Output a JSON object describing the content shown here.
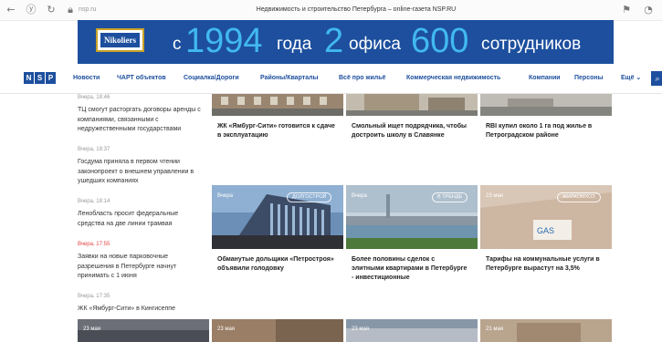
{
  "browser": {
    "url": "nsp.ru",
    "title": "Недвижимость и строительство Петербурга – online-газета NSP.RU"
  },
  "banner": {
    "logo": "Nikoliers",
    "text_prefix": "с",
    "num1": "1994",
    "word1": "года",
    "num2": "2",
    "word2": "офиса",
    "num3": "600",
    "word3": "сотрудников"
  },
  "nav": {
    "logo_letters": [
      "N",
      "S",
      "P"
    ],
    "items": [
      "Новости",
      "ЧАРТ объектов",
      "Социалка/Дороги",
      "Районы/Кварталы",
      "Всё про жильё",
      "Коммерческая недвижимость",
      "Компании",
      "Персоны",
      "Ещё"
    ]
  },
  "feed": [
    {
      "time": "Вчера, 18:46",
      "text": "ТЦ смогут расторгать договоры аренды с компаниями, связанными с недружественными государствами"
    },
    {
      "time": "Вчера, 18:37",
      "text": "Госдума приняла в первом чтении законопроект о внешнем управлении в ушедших компаниях"
    },
    {
      "time": "Вчера, 18:14",
      "text": "Ленобласть просит федеральные средства на две линии трамвая"
    },
    {
      "time": "Вчера, 17:55",
      "text": "Заявки на новые парковочные разрешения в Петербурге начнут принимать с 1 июня"
    },
    {
      "time": "Вчера, 17:35",
      "text": "ЖК «Ямбург-Сити» в Кингисеппе"
    }
  ],
  "cards_top": [
    {
      "title": "ЖК «Ямбург-Сити» готовится к сдаче в эксплуатацию"
    },
    {
      "title": "Смольный ищет подрядчика, чтобы достроить школу в Славянке"
    },
    {
      "title": "RBI купил около 1 га под жилье в Петроградском районе"
    }
  ],
  "cards_mid": [
    {
      "date": "Вчера",
      "tag": "ДОЛГОСТРОЙ",
      "title": "Обманутые дольщики «Петростроя» объявили голодовку"
    },
    {
      "date": "Вчера",
      "tag": "В ТРЕНДЕ",
      "title": "Более половины сделок с элитными квартирами в Петербурге - инвестиционные"
    },
    {
      "date": "23 мая",
      "tag": "ЖИЛКОМХОЗ",
      "title": "Тарифы на коммунальные услуги в Петербурге вырастут на 3,5%"
    }
  ],
  "cards_bottom": [
    {
      "date": "23 мая"
    },
    {
      "date": "23 мая"
    },
    {
      "date": "23 мая"
    },
    {
      "date": "21 мая"
    }
  ]
}
